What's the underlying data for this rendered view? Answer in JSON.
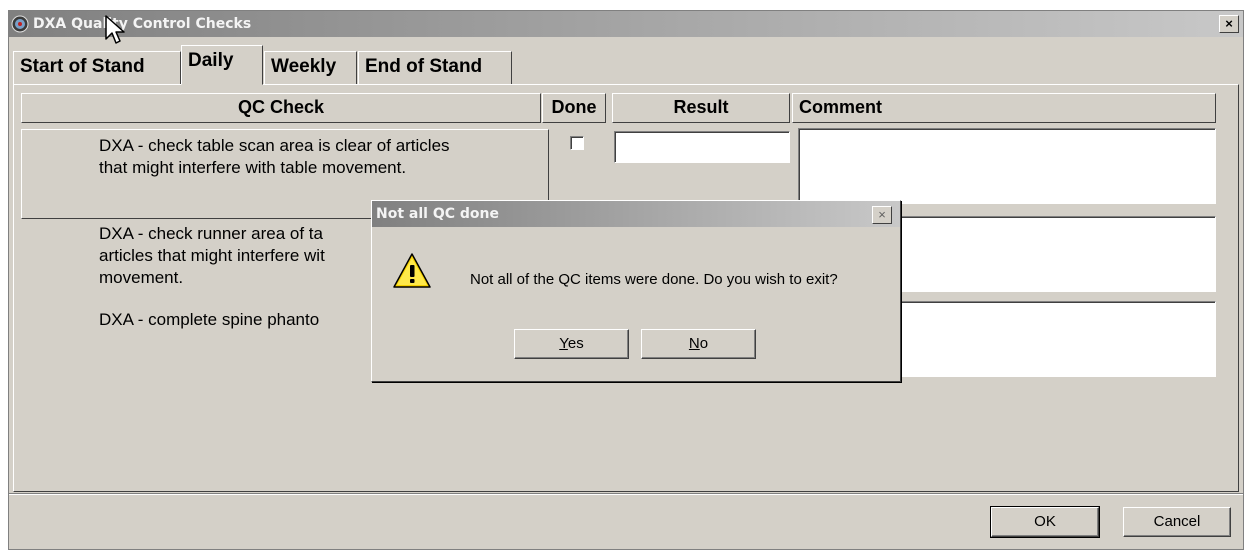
{
  "window": {
    "title": "DXA Quality Control Checks",
    "close_glyph": "×"
  },
  "tabs": [
    {
      "label": "Start of Stand"
    },
    {
      "label": "Daily"
    },
    {
      "label": "Weekly"
    },
    {
      "label": "End of Stand"
    }
  ],
  "table": {
    "headers": {
      "qc_check": "QC Check",
      "done": "Done",
      "result": "Result",
      "comment": "Comment"
    },
    "rows": [
      {
        "check_line1": "DXA - check table scan area is clear of articles",
        "check_line2": "that might interfere with table movement."
      },
      {
        "check_line1": "DXA - check runner area of ta",
        "check_line2": "articles that might interfere wit",
        "check_line3": "movement."
      },
      {
        "check_line1": "DXA - complete spine phanto"
      }
    ]
  },
  "footer": {
    "ok_label": "OK",
    "cancel_label": "Cancel"
  },
  "dialog": {
    "title": "Not all QC done",
    "message": "Not all of the QC items were done. Do you wish to exit?",
    "close_glyph": "×",
    "yes_mnemonic": "Y",
    "yes_rest": "es",
    "no_mnemonic": "N",
    "no_rest": "o",
    "icon": "warning-icon"
  }
}
